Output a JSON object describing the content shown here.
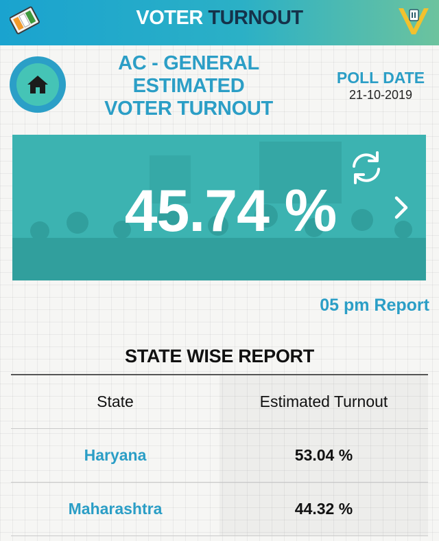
{
  "header": {
    "title_part1": "VOTER",
    "title_part2": "TURNOUT",
    "left_icon": "evm-ballot-icon",
    "right_icon": "voter-v-logo"
  },
  "heading": {
    "line1": "AC - GENERAL",
    "line2": "ESTIMATED",
    "line3": "VOTER TURNOUT"
  },
  "poll": {
    "label": "POLL DATE",
    "date": "21-10-2019"
  },
  "turnout": {
    "value": "45.74 %",
    "report_time": "05 pm Report"
  },
  "state_report": {
    "title": "STATE WISE REPORT",
    "columns": [
      "State",
      "Estimated Turnout"
    ],
    "rows": [
      {
        "state": "Haryana",
        "turnout": "53.04 %"
      },
      {
        "state": "Maharashtra",
        "turnout": "44.32 %"
      }
    ]
  },
  "colors": {
    "accent": "#2b9ec6",
    "card": "#3cb3b1",
    "header_gradient_start": "#1aa3cf",
    "header_gradient_end": "#6cc39e"
  }
}
